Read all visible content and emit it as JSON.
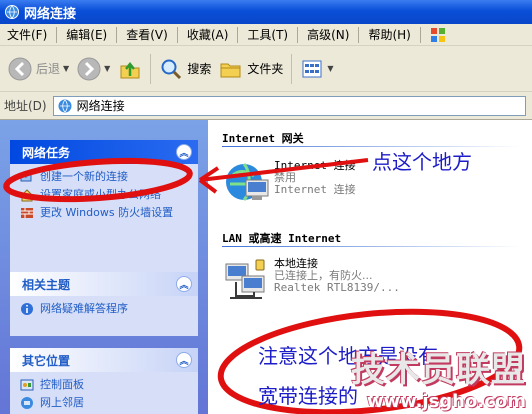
{
  "window": {
    "title": "网络连接"
  },
  "menu": [
    "文件(F)",
    "编辑(E)",
    "查看(V)",
    "收藏(A)",
    "工具(T)",
    "高级(N)",
    "帮助(H)"
  ],
  "toolbar": {
    "back_label": "后退",
    "search_label": "搜索",
    "folders_label": "文件夹"
  },
  "address": {
    "label": "地址(D)",
    "value": "网络连接"
  },
  "left_panels": {
    "network_tasks": {
      "title": "网络任务",
      "items": [
        "创建一个新的连接",
        "设置家庭或小型办公网络",
        "更改 Windows 防火墙设置"
      ]
    },
    "related": {
      "title": "相关主题",
      "items": [
        "网络疑难解答程序"
      ]
    },
    "other_places": {
      "title": "其它位置",
      "items": [
        "控制面板",
        "网上邻居"
      ]
    }
  },
  "groups": {
    "internet_gateway": {
      "title": "Internet 网关",
      "conn": {
        "name": "Internet 连接",
        "status": "禁用",
        "device": "Internet 连接"
      }
    },
    "lan": {
      "title": "LAN 或高速 Internet",
      "conn": {
        "name": "本地连接",
        "status": "已连接上，有防火...",
        "device": "Realtek RTL8139/..."
      }
    }
  },
  "annotations": {
    "click_here": "点这个地方",
    "note_line1": "注意这个地方是没有",
    "note_line2": "宽带连接的"
  },
  "watermark": {
    "brand": "技术员联盟",
    "url": "www.jsgho.com"
  },
  "colors": {
    "title_bar": "#0a4fd8",
    "task_pane": "#6f8fe0",
    "annotation_red": "#e01010",
    "annotation_blue": "#1c1cc8"
  }
}
